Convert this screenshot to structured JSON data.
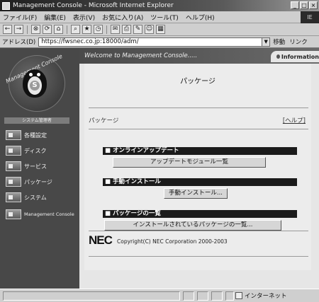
{
  "window": {
    "title": "Management Console - Microsoft Internet Explorer",
    "buttons": [
      "_",
      "□",
      "×"
    ]
  },
  "menubar": {
    "items": [
      "ファイル(F)",
      "編集(E)",
      "表示(V)",
      "お気に入り(A)",
      "ツール(T)",
      "ヘルプ(H)"
    ],
    "throbber": "IE"
  },
  "toolbar": {
    "buttons": [
      "←",
      "→",
      "⊗",
      "⟳",
      "⌂",
      "⌕",
      "★",
      "◷",
      "✉",
      "⎙",
      "✎",
      "☺",
      "▦"
    ]
  },
  "addressbar": {
    "label": "アドレス(D)",
    "url": "https://fwsnec.co.jp:18000/adm/",
    "go": "移動",
    "links": "リンク"
  },
  "sidebar": {
    "logo_text": "Management Console",
    "badge": "S",
    "system_label": "システム管理者",
    "items": [
      {
        "label": "各種設定"
      },
      {
        "label": "ディスク"
      },
      {
        "label": "サービス"
      },
      {
        "label": "パッケージ"
      },
      {
        "label": "システム"
      },
      {
        "label": "Management Console"
      }
    ]
  },
  "header": {
    "welcome": "Welcome to Management Console.....",
    "info_tab": "Information"
  },
  "main": {
    "title": "パッケージ",
    "breadcrumb": "パッケージ",
    "help": "[ヘルプ]",
    "sections": [
      {
        "heading": "■ オンラインアップデート",
        "button": "アップデートモジュール一覧"
      },
      {
        "heading": "■ 手動インストール",
        "button": "手動インストール..."
      },
      {
        "heading": "■ パッケージの一覧",
        "button": "インストールされているパッケージの一覧..."
      }
    ]
  },
  "footer": {
    "logo": "NEC",
    "copyright": "Copyright(C) NEC Corporation 2000-2003"
  },
  "statusbar": {
    "zone": "インターネット"
  }
}
